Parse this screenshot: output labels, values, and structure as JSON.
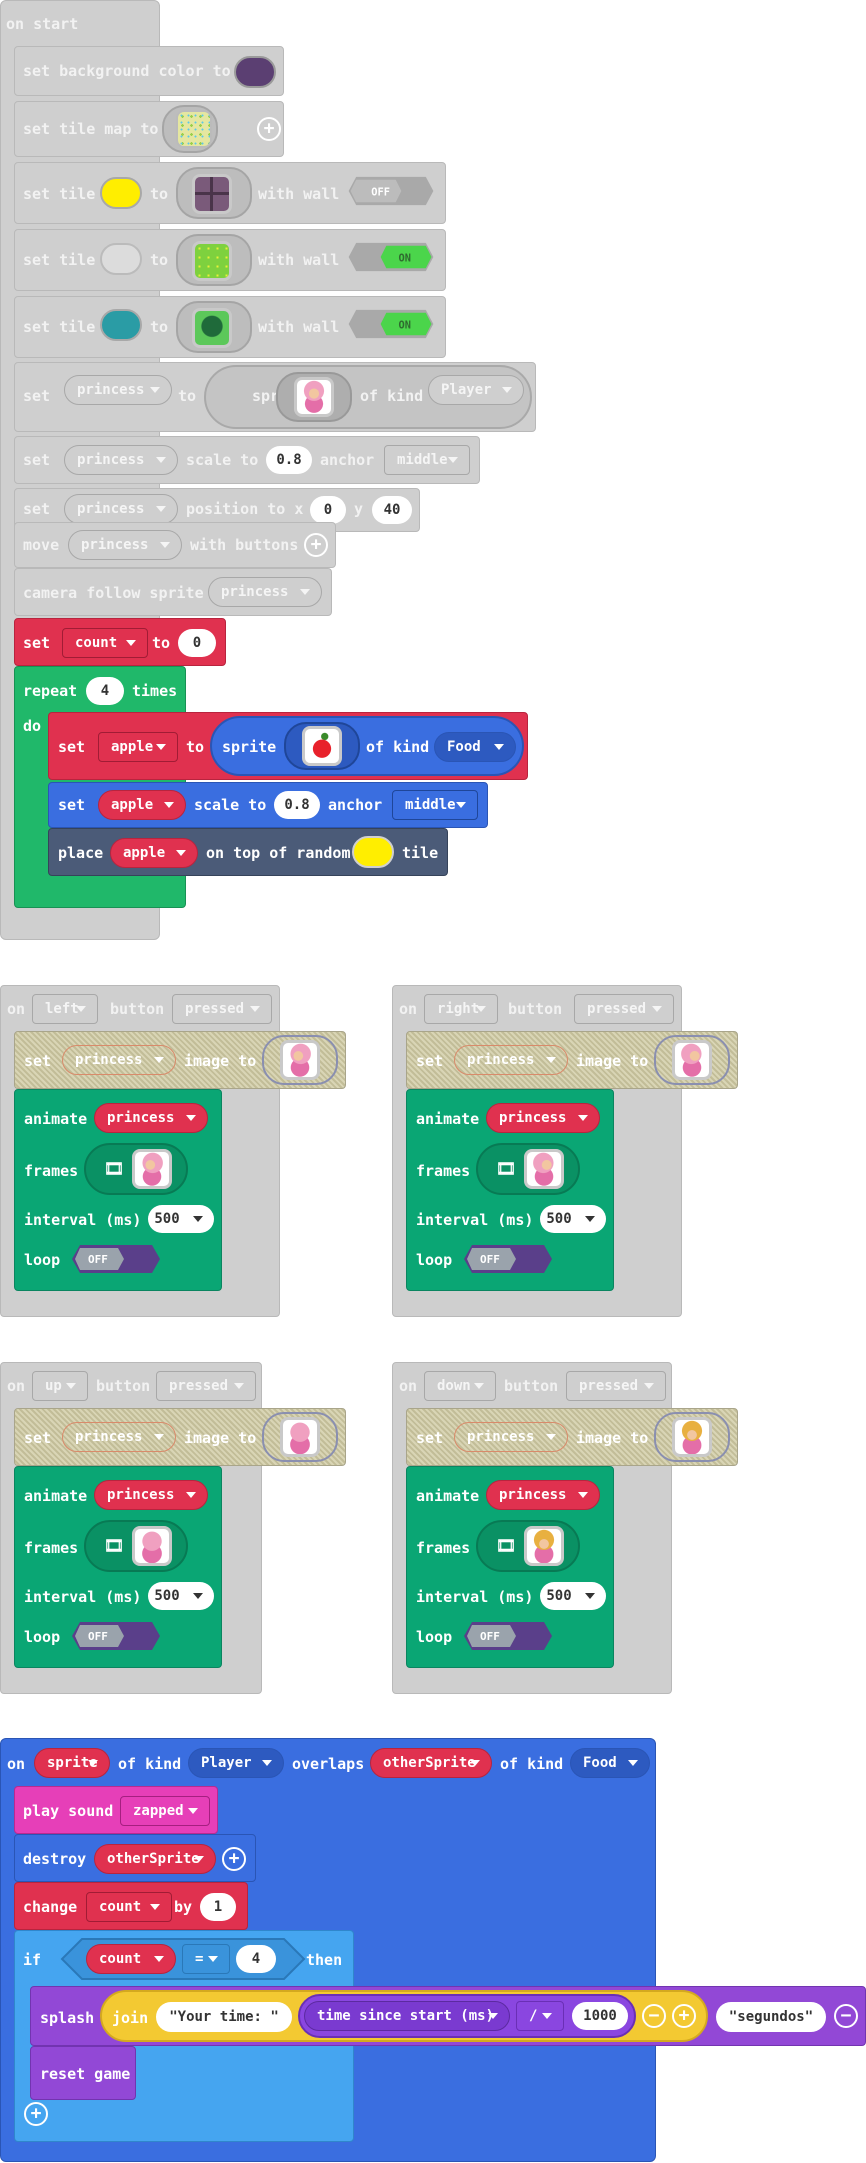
{
  "colors": {
    "disabled": "#cfcfcf",
    "variables": "#e0314f",
    "loops": "#20b86a",
    "sprites": "#3a6ee0",
    "scene": "#4b5b78",
    "animation": "#0aa674",
    "events": "#3a6ee0",
    "music": "#e63fb8",
    "logic": "#45a5f0",
    "text": "#f3c932",
    "math": "#8a46e0",
    "game": "#9248d6",
    "wall_on": "#4bd54b",
    "bg_color": "#5b3f72",
    "yellow_tile": "#ffee00",
    "teal_tile": "#2a9ca5"
  },
  "on_start": {
    "hat": "on start",
    "bg": {
      "set": "set background color to"
    },
    "tilemap": {
      "label": "set tile map to",
      "icon": "tilemap-icon"
    },
    "tile1": {
      "set": "set tile",
      "to": "to",
      "with_wall": "with wall",
      "wall": "OFF",
      "icon": "brick-wall-tile-icon"
    },
    "tile2": {
      "set": "set tile",
      "to": "to",
      "with_wall": "with wall",
      "wall": "ON",
      "icon": "grass-tile-icon"
    },
    "tile3": {
      "set": "set tile",
      "to": "to",
      "with_wall": "with wall",
      "wall": "ON",
      "icon": "tree-tile-icon"
    },
    "sprite": {
      "set": "set",
      "var": "princess",
      "to": "to",
      "sprite": "sprite",
      "of_kind": "of kind",
      "kind": "Player",
      "icon": "princess-sprite-icon"
    },
    "scale": {
      "set": "set",
      "var": "princess",
      "scale_to": "scale to",
      "value": "0.8",
      "anchor": "anchor",
      "anchor_value": "middle"
    },
    "position": {
      "set": "set",
      "var": "princess",
      "position_to": "position to x",
      "x": "0",
      "y_label": "y",
      "y": "40"
    },
    "move": {
      "move": "move",
      "var": "princess",
      "with_buttons": "with buttons"
    },
    "camera": {
      "label": "camera follow sprite",
      "var": "princess"
    },
    "count": {
      "set": "set",
      "var": "count",
      "to": "to",
      "value": "0"
    },
    "repeat": {
      "repeat": "repeat",
      "times_value": "4",
      "times": "times",
      "do": "do"
    },
    "apple": {
      "set": "set",
      "var": "apple",
      "to": "to",
      "sprite": "sprite",
      "of_kind": "of kind",
      "kind": "Food",
      "icon": "apple-sprite-icon"
    },
    "apple_scale": {
      "set": "set",
      "var": "apple",
      "scale_to": "scale to",
      "value": "0.8",
      "anchor": "anchor",
      "anchor_value": "middle"
    },
    "place": {
      "place": "place",
      "var": "apple",
      "on_top": "on top of random",
      "tile": "tile"
    }
  },
  "button_handlers": [
    {
      "on": "on",
      "button": "left",
      "button_label": "button",
      "event": "pressed",
      "set": "set",
      "var": "princess",
      "image_to": "image to",
      "animate": "animate",
      "anim_var": "princess",
      "frames": "frames",
      "interval": "interval (ms)",
      "interval_value": "500",
      "loop": "loop",
      "loop_value": "OFF"
    },
    {
      "on": "on",
      "button": "right",
      "button_label": "button",
      "event": "pressed",
      "set": "set",
      "var": "princess",
      "image_to": "image to",
      "animate": "animate",
      "anim_var": "princess",
      "frames": "frames",
      "interval": "interval (ms)",
      "interval_value": "500",
      "loop": "loop",
      "loop_value": "OFF"
    },
    {
      "on": "on",
      "button": "up",
      "button_label": "button",
      "event": "pressed",
      "set": "set",
      "var": "princess",
      "image_to": "image to",
      "animate": "animate",
      "anim_var": "princess",
      "frames": "frames",
      "interval": "interval (ms)",
      "interval_value": "500",
      "loop": "loop",
      "loop_value": "OFF"
    },
    {
      "on": "on",
      "button": "down",
      "button_label": "button",
      "event": "pressed",
      "set": "set",
      "var": "princess",
      "image_to": "image to",
      "animate": "animate",
      "anim_var": "princess",
      "frames": "frames",
      "interval": "interval (ms)",
      "interval_value": "500",
      "loop": "loop",
      "loop_value": "OFF"
    }
  ],
  "overlap": {
    "on": "on",
    "sprite": "sprite",
    "of_kind": "of kind",
    "kind": "Player",
    "overlaps": "overlaps",
    "other": "otherSprite",
    "of_kind2": "of kind",
    "kind2": "Food",
    "play_sound": "play sound",
    "sound": "zapped",
    "destroy": "destroy",
    "destroy_var": "otherSprite",
    "change": "change",
    "change_var": "count",
    "by": "by",
    "by_value": "1",
    "if": "if",
    "cond_var": "count",
    "op": "=",
    "cond_value": "4",
    "then": "then",
    "splash": "splash",
    "join": "join",
    "join_text": "Your time: ",
    "time": "time since start (ms)",
    "div": "/",
    "div_value": "1000",
    "segundos": "segundos",
    "reset": "reset game"
  }
}
